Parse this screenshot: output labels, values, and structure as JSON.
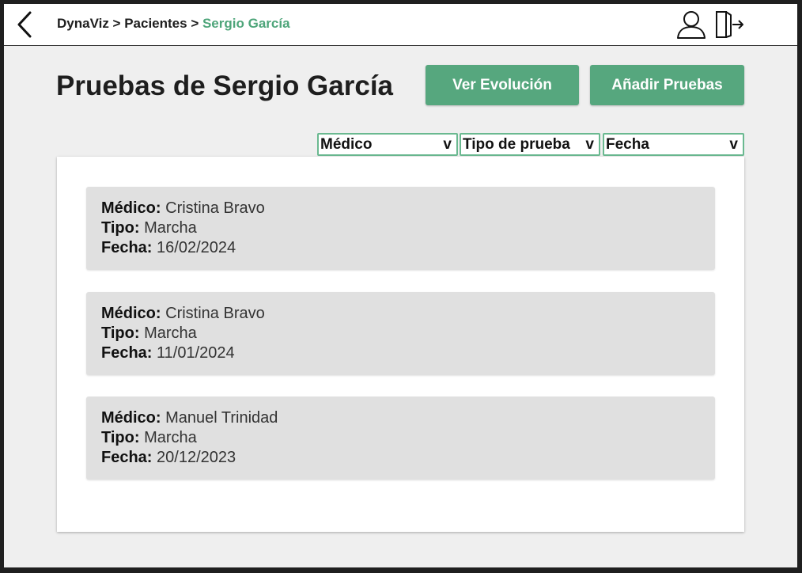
{
  "breadcrumb": {
    "app": "DynaViz",
    "separator": " > ",
    "section": "Pacientes",
    "current": "Sergio García"
  },
  "page": {
    "title": "Pruebas de Sergio García"
  },
  "actions": {
    "evolution_label": "Ver Evolución",
    "add_label": "Añadir Pruebas"
  },
  "filters": [
    {
      "label": "Médico",
      "arrow": "v"
    },
    {
      "label": "Tipo de prueba",
      "arrow": "v"
    },
    {
      "label": "Fecha",
      "arrow": "v"
    }
  ],
  "labels": {
    "doctor": "Médico:",
    "type": "Tipo:",
    "date": "Fecha:"
  },
  "tests": [
    {
      "doctor": "Cristina Bravo",
      "type": "Marcha",
      "date": "16/02/2024"
    },
    {
      "doctor": "Cristina Bravo",
      "type": "Marcha",
      "date": "11/01/2024"
    },
    {
      "doctor": "Manuel Trinidad",
      "type": "Marcha",
      "date": "20/12/2023"
    }
  ],
  "icons": {
    "back": "chevron-left-icon",
    "user": "user-icon",
    "logout": "logout-icon"
  },
  "colors": {
    "accent": "#56a77e",
    "breadcrumb_current": "#4ea57a",
    "filter_border": "#6ab990",
    "card_bg": "#e0e0e0",
    "page_bg": "#efefef"
  }
}
